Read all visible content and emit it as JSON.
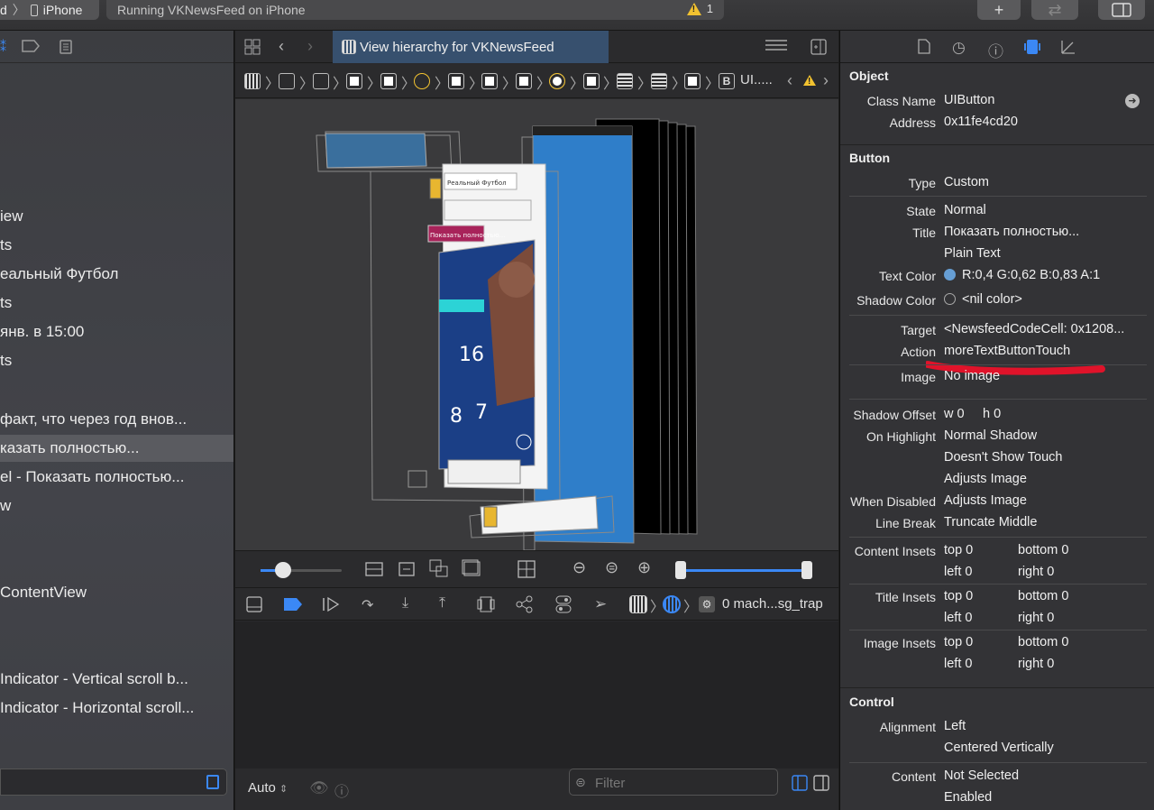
{
  "toolbar": {
    "scheme_prefix": "d",
    "device": "iPhone",
    "status": "Running VKNewsFeed on iPhone",
    "warning_count": "1",
    "add_label": "+"
  },
  "navigator": {
    "rows": [
      {
        "label": "iew"
      },
      {
        "label": "ts"
      },
      {
        "label": "еальный Футбол"
      },
      {
        "label": "ts"
      },
      {
        "label": "янв. в 15:00"
      },
      {
        "label": "ts"
      },
      {
        "label": " факт, что через год внов..."
      },
      {
        "label": "казать полностью..."
      },
      {
        "label": "el - Показать полностью..."
      },
      {
        "label": "w"
      },
      {
        "label": "ContentView"
      },
      {
        "label": " Indicator - Vertical scroll b..."
      },
      {
        "label": " Indicator - Horizontal scroll..."
      }
    ]
  },
  "editor": {
    "tab_title": "View hierarchy for VKNewsFeed",
    "jump_last": "UI.....",
    "debug_frame": "0 mach...sg_trap",
    "auto_label": "Auto",
    "filter_placeholder": "Filter",
    "canvas_caption": "Показать полностью...",
    "preview_header": "Реальный Футбол",
    "preview_numbers": [
      "16",
      "8",
      "7"
    ]
  },
  "inspector": {
    "object": {
      "title": "Object",
      "class_name_label": "Class Name",
      "class_name": "UIButton",
      "address_label": "Address",
      "address": "0x11fe4cd20"
    },
    "button": {
      "title": "Button",
      "type_label": "Type",
      "type": "Custom",
      "state_label": "State",
      "state": "Normal",
      "title_label": "Title",
      "title_value": "Показать полностью...",
      "title_kind": "Plain Text",
      "text_color_label": "Text Color",
      "text_color": "R:0,4 G:0,62 B:0,83 A:1",
      "text_color_hex": "#669ed4",
      "shadow_color_label": "Shadow Color",
      "shadow_color": "<nil color>",
      "target_label": "Target",
      "target": "<NewsfeedCodeCell: 0x1208...",
      "action_label": "Action",
      "action": "moreTextButtonTouch",
      "image_label": "Image",
      "image": "No image",
      "shadow_offset_label": "Shadow Offset",
      "shadow_offset_w": "w 0",
      "shadow_offset_h": "h 0",
      "on_highlight_label": "On Highlight",
      "on_highlight": [
        "Normal Shadow",
        "Doesn't Show Touch",
        "Adjusts Image"
      ],
      "when_disabled_label": "When Disabled",
      "when_disabled": "Adjusts Image",
      "line_break_label": "Line Break",
      "line_break": "Truncate Middle",
      "content_insets_label": "Content Insets",
      "title_insets_label": "Title Insets",
      "image_insets_label": "Image Insets",
      "inset_top": "top 0",
      "inset_bottom": "bottom 0",
      "inset_left": "left 0",
      "inset_right": "right 0"
    },
    "control": {
      "title": "Control",
      "alignment_label": "Alignment",
      "alignment_h": "Left",
      "alignment_v": "Centered Vertically",
      "content_label": "Content",
      "content_value": "Not Selected",
      "content_value2": "Enabled"
    }
  },
  "colors": {
    "accent": "#3b88f5",
    "annotation": "#e0132a",
    "warning": "#f2c230"
  }
}
